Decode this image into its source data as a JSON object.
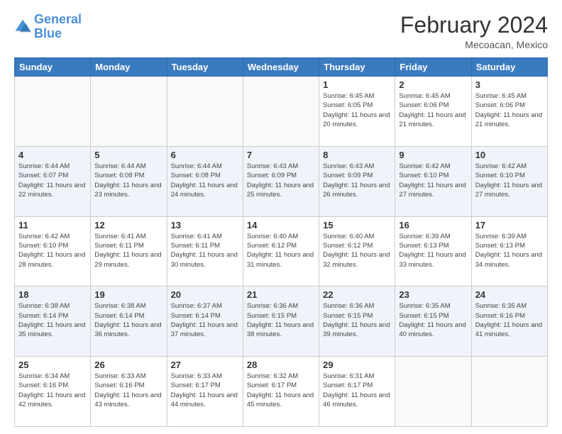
{
  "logo": {
    "line1": "General",
    "line2": "Blue"
  },
  "header": {
    "month": "February 2024",
    "location": "Mecoacan, Mexico"
  },
  "weekdays": [
    "Sunday",
    "Monday",
    "Tuesday",
    "Wednesday",
    "Thursday",
    "Friday",
    "Saturday"
  ],
  "weeks": [
    [
      {
        "day": "",
        "info": ""
      },
      {
        "day": "",
        "info": ""
      },
      {
        "day": "",
        "info": ""
      },
      {
        "day": "",
        "info": ""
      },
      {
        "day": "1",
        "info": "Sunrise: 6:45 AM\nSunset: 6:05 PM\nDaylight: 11 hours\nand 20 minutes."
      },
      {
        "day": "2",
        "info": "Sunrise: 6:45 AM\nSunset: 6:06 PM\nDaylight: 11 hours\nand 21 minutes."
      },
      {
        "day": "3",
        "info": "Sunrise: 6:45 AM\nSunset: 6:06 PM\nDaylight: 11 hours\nand 21 minutes."
      }
    ],
    [
      {
        "day": "4",
        "info": "Sunrise: 6:44 AM\nSunset: 6:07 PM\nDaylight: 11 hours\nand 22 minutes."
      },
      {
        "day": "5",
        "info": "Sunrise: 6:44 AM\nSunset: 6:08 PM\nDaylight: 11 hours\nand 23 minutes."
      },
      {
        "day": "6",
        "info": "Sunrise: 6:44 AM\nSunset: 6:08 PM\nDaylight: 11 hours\nand 24 minutes."
      },
      {
        "day": "7",
        "info": "Sunrise: 6:43 AM\nSunset: 6:09 PM\nDaylight: 11 hours\nand 25 minutes."
      },
      {
        "day": "8",
        "info": "Sunrise: 6:43 AM\nSunset: 6:09 PM\nDaylight: 11 hours\nand 26 minutes."
      },
      {
        "day": "9",
        "info": "Sunrise: 6:42 AM\nSunset: 6:10 PM\nDaylight: 11 hours\nand 27 minutes."
      },
      {
        "day": "10",
        "info": "Sunrise: 6:42 AM\nSunset: 6:10 PM\nDaylight: 11 hours\nand 27 minutes."
      }
    ],
    [
      {
        "day": "11",
        "info": "Sunrise: 6:42 AM\nSunset: 6:10 PM\nDaylight: 11 hours\nand 28 minutes."
      },
      {
        "day": "12",
        "info": "Sunrise: 6:41 AM\nSunset: 6:11 PM\nDaylight: 11 hours\nand 29 minutes."
      },
      {
        "day": "13",
        "info": "Sunrise: 6:41 AM\nSunset: 6:11 PM\nDaylight: 11 hours\nand 30 minutes."
      },
      {
        "day": "14",
        "info": "Sunrise: 6:40 AM\nSunset: 6:12 PM\nDaylight: 11 hours\nand 31 minutes."
      },
      {
        "day": "15",
        "info": "Sunrise: 6:40 AM\nSunset: 6:12 PM\nDaylight: 11 hours\nand 32 minutes."
      },
      {
        "day": "16",
        "info": "Sunrise: 6:39 AM\nSunset: 6:13 PM\nDaylight: 11 hours\nand 33 minutes."
      },
      {
        "day": "17",
        "info": "Sunrise: 6:39 AM\nSunset: 6:13 PM\nDaylight: 11 hours\nand 34 minutes."
      }
    ],
    [
      {
        "day": "18",
        "info": "Sunrise: 6:38 AM\nSunset: 6:14 PM\nDaylight: 11 hours\nand 35 minutes."
      },
      {
        "day": "19",
        "info": "Sunrise: 6:38 AM\nSunset: 6:14 PM\nDaylight: 11 hours\nand 36 minutes."
      },
      {
        "day": "20",
        "info": "Sunrise: 6:37 AM\nSunset: 6:14 PM\nDaylight: 11 hours\nand 37 minutes."
      },
      {
        "day": "21",
        "info": "Sunrise: 6:36 AM\nSunset: 6:15 PM\nDaylight: 11 hours\nand 38 minutes."
      },
      {
        "day": "22",
        "info": "Sunrise: 6:36 AM\nSunset: 6:15 PM\nDaylight: 11 hours\nand 39 minutes."
      },
      {
        "day": "23",
        "info": "Sunrise: 6:35 AM\nSunset: 6:15 PM\nDaylight: 11 hours\nand 40 minutes."
      },
      {
        "day": "24",
        "info": "Sunrise: 6:35 AM\nSunset: 6:16 PM\nDaylight: 11 hours\nand 41 minutes."
      }
    ],
    [
      {
        "day": "25",
        "info": "Sunrise: 6:34 AM\nSunset: 6:16 PM\nDaylight: 11 hours\nand 42 minutes."
      },
      {
        "day": "26",
        "info": "Sunrise: 6:33 AM\nSunset: 6:16 PM\nDaylight: 11 hours\nand 43 minutes."
      },
      {
        "day": "27",
        "info": "Sunrise: 6:33 AM\nSunset: 6:17 PM\nDaylight: 11 hours\nand 44 minutes."
      },
      {
        "day": "28",
        "info": "Sunrise: 6:32 AM\nSunset: 6:17 PM\nDaylight: 11 hours\nand 45 minutes."
      },
      {
        "day": "29",
        "info": "Sunrise: 6:31 AM\nSunset: 6:17 PM\nDaylight: 11 hours\nand 46 minutes."
      },
      {
        "day": "",
        "info": ""
      },
      {
        "day": "",
        "info": ""
      }
    ]
  ]
}
